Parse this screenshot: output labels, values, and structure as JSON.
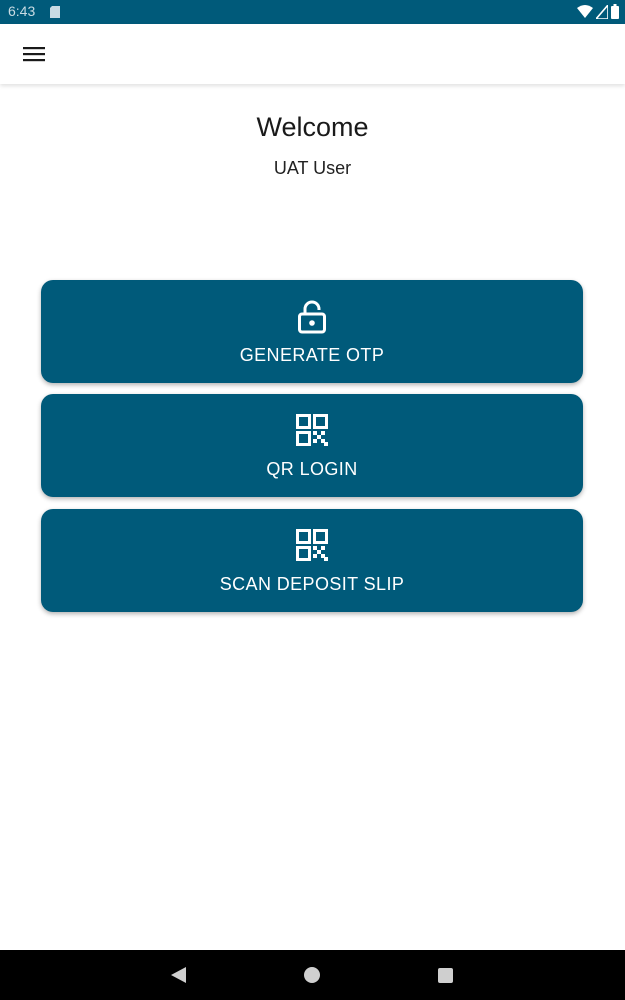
{
  "status_bar": {
    "time": "6:43",
    "sd_icon": "sd-card-icon",
    "wifi_icon": "wifi-icon",
    "signal_icon": "cell-signal-icon",
    "battery_icon": "battery-icon",
    "background_color": "#005a7a"
  },
  "app_bar": {
    "menu_icon": "hamburger-menu-icon"
  },
  "greeting": {
    "title": "Welcome",
    "user_name": "UAT User"
  },
  "actions": [
    {
      "label": "GENERATE OTP",
      "icon": "unlock-icon"
    },
    {
      "label": "QR LOGIN",
      "icon": "qr-code-icon"
    },
    {
      "label": "SCAN DEPOSIT SLIP",
      "icon": "qr-code-icon"
    }
  ],
  "navigation_bar": {
    "back_icon": "back-triangle-icon",
    "home_icon": "home-circle-icon",
    "recents_icon": "recents-square-icon"
  },
  "colors": {
    "primary": "#005a7a",
    "on_primary": "#ffffff",
    "background": "#ffffff",
    "nav_bar": "#000000"
  }
}
